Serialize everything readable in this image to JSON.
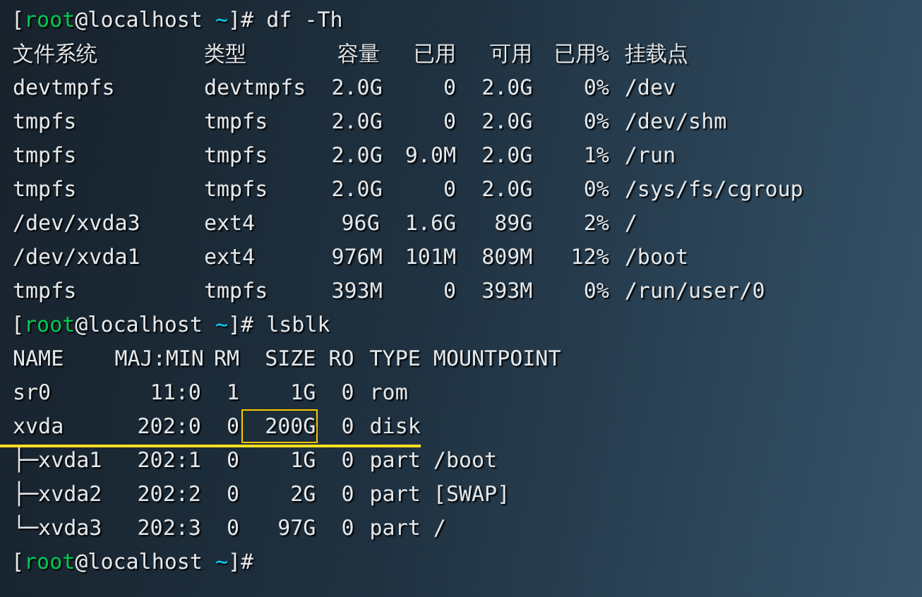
{
  "terminal": {
    "blocks": [
      {
        "kind": "prompt",
        "segments": [
          {
            "text": "[",
            "kind": "plain"
          },
          {
            "text": "root",
            "kind": "user"
          },
          {
            "text": "@localhost ",
            "kind": "plain"
          },
          {
            "text": "~",
            "kind": "cwd"
          },
          {
            "text": "]# df -Th",
            "kind": "plain"
          }
        ]
      },
      {
        "kind": "df",
        "rows": [
          {
            "cells": [
              "文件系统",
              "类型",
              "容量",
              "已用",
              "可用",
              "已用%",
              "挂载点"
            ]
          },
          {
            "cells": [
              "devtmpfs",
              "devtmpfs",
              "2.0G",
              "0",
              "2.0G",
              "0%",
              "/dev"
            ]
          },
          {
            "cells": [
              "tmpfs",
              "tmpfs",
              "2.0G",
              "0",
              "2.0G",
              "0%",
              "/dev/shm"
            ]
          },
          {
            "cells": [
              "tmpfs",
              "tmpfs",
              "2.0G",
              "9.0M",
              "2.0G",
              "1%",
              "/run"
            ]
          },
          {
            "cells": [
              "tmpfs",
              "tmpfs",
              "2.0G",
              "0",
              "2.0G",
              "0%",
              "/sys/fs/cgroup"
            ]
          },
          {
            "cells": [
              "/dev/xvda3",
              "ext4",
              "96G",
              "1.6G",
              "89G",
              "2%",
              "/"
            ]
          },
          {
            "cells": [
              "/dev/xvda1",
              "ext4",
              "976M",
              "101M",
              "809M",
              "12%",
              "/boot"
            ]
          },
          {
            "cells": [
              "tmpfs",
              "tmpfs",
              "393M",
              "0",
              "393M",
              "0%",
              "/run/user/0"
            ]
          }
        ]
      },
      {
        "kind": "prompt",
        "segments": [
          {
            "text": "[",
            "kind": "plain"
          },
          {
            "text": "root",
            "kind": "user"
          },
          {
            "text": "@localhost ",
            "kind": "plain"
          },
          {
            "text": "~",
            "kind": "cwd"
          },
          {
            "text": "]# lsblk",
            "kind": "plain"
          }
        ]
      },
      {
        "kind": "lsblk",
        "rows": [
          {
            "cells": [
              "NAME",
              "MAJ:MIN",
              "RM",
              "SIZE",
              "RO",
              "TYPE",
              "MOUNTPOINT"
            ],
            "underlined": false,
            "size_boxed": false
          },
          {
            "cells": [
              "sr0",
              "11:0",
              "1",
              "1G",
              "0",
              "rom"
            ],
            "underlined": false,
            "size_boxed": false
          },
          {
            "cells": [
              "xvda",
              "202:0",
              "0",
              "200G",
              "0",
              "disk"
            ],
            "underlined": true,
            "size_boxed": true
          },
          {
            "cells": [
              "├─xvda1",
              "202:1",
              "0",
              "1G",
              "0",
              "part",
              "/boot"
            ],
            "underlined": false,
            "size_boxed": false
          },
          {
            "cells": [
              "├─xvda2",
              "202:2",
              "0",
              "2G",
              "0",
              "part",
              "[SWAP]"
            ],
            "underlined": false,
            "size_boxed": false
          },
          {
            "cells": [
              "└─xvda3",
              "202:3",
              "0",
              "97G",
              "0",
              "part",
              "/"
            ],
            "underlined": false,
            "size_boxed": false
          }
        ]
      },
      {
        "kind": "prompt",
        "segments": [
          {
            "text": "[",
            "kind": "plain"
          },
          {
            "text": "root",
            "kind": "user"
          },
          {
            "text": "@localhost ",
            "kind": "plain"
          },
          {
            "text": "~",
            "kind": "cwd"
          },
          {
            "text": "]#",
            "kind": "plain"
          }
        ]
      }
    ]
  }
}
